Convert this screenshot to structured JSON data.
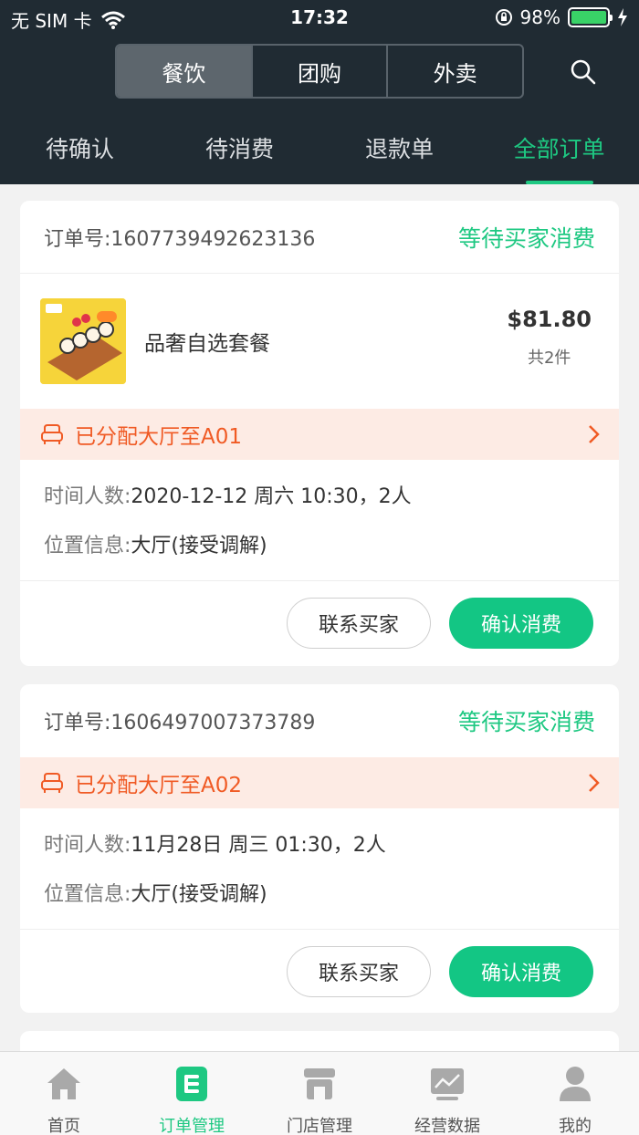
{
  "status_bar": {
    "carrier": "无 SIM 卡",
    "time": "17:32",
    "battery": "98%"
  },
  "segments": [
    {
      "label": "餐饮",
      "active": true
    },
    {
      "label": "团购",
      "active": false
    },
    {
      "label": "外卖",
      "active": false
    }
  ],
  "tabs": [
    {
      "label": "待确认"
    },
    {
      "label": "待消费"
    },
    {
      "label": "退款单"
    },
    {
      "label": "全部订单"
    }
  ],
  "orders": [
    {
      "order_no": "订单号:1607739492623136",
      "status": "等待买家消费",
      "product": {
        "name": "品奢自选套餐",
        "price": "$81.80",
        "qty": "共2件"
      },
      "assign": "已分配大厅至A01",
      "time_label": "时间人数:",
      "time_value": "2020-12-12 周六 10:30，2人",
      "loc_label": "位置信息:",
      "loc_value": "大厅(接受调解)",
      "btn_contact": "联系买家",
      "btn_confirm": "确认消费"
    },
    {
      "order_no": "订单号:1606497007373789",
      "status": "等待买家消费",
      "assign": "已分配大厅至A02",
      "time_label": "时间人数:",
      "time_value": "11月28日 周三 01:30，2人",
      "loc_label": "位置信息:",
      "loc_value": "大厅(接受调解)",
      "btn_contact": "联系买家",
      "btn_confirm": "确认消费"
    }
  ],
  "tabbar": [
    {
      "label": "首页",
      "icon": "home-icon"
    },
    {
      "label": "订单管理",
      "icon": "order-icon"
    },
    {
      "label": "门店管理",
      "icon": "store-icon"
    },
    {
      "label": "经营数据",
      "icon": "chart-icon"
    },
    {
      "label": "我的",
      "icon": "user-icon"
    }
  ],
  "colors": {
    "accent": "#1ec882",
    "header": "#202b33",
    "warning": "#f05a24"
  }
}
